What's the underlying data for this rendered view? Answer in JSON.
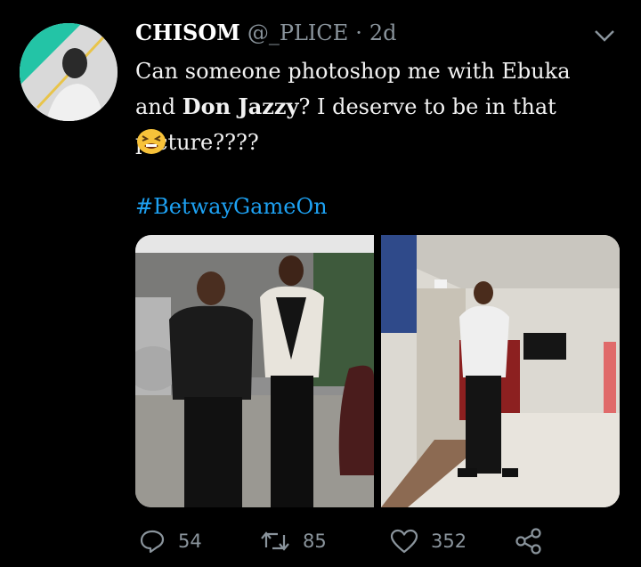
{
  "tweet": {
    "display_name": "CHISOM",
    "handle": "@_PLICE",
    "separator": "·",
    "time": "2d",
    "text_part1": "Can someone photoshop me with Ebuka and ",
    "text_bold": "Don Jazzy",
    "text_part2": "? I deserve to be in that picture????",
    "hashtag": "#BetwayGameOn",
    "emoji": "tired-face-emoji"
  },
  "actions": {
    "reply_count": "54",
    "retweet_count": "85",
    "like_count": "352"
  },
  "icons": {
    "caret": "chevron-down-icon",
    "reply": "reply-icon",
    "retweet": "retweet-icon",
    "like": "heart-icon",
    "share": "share-icon"
  },
  "colors": {
    "background": "#000000",
    "link": "#1da1f2",
    "muted": "#8a949c"
  }
}
